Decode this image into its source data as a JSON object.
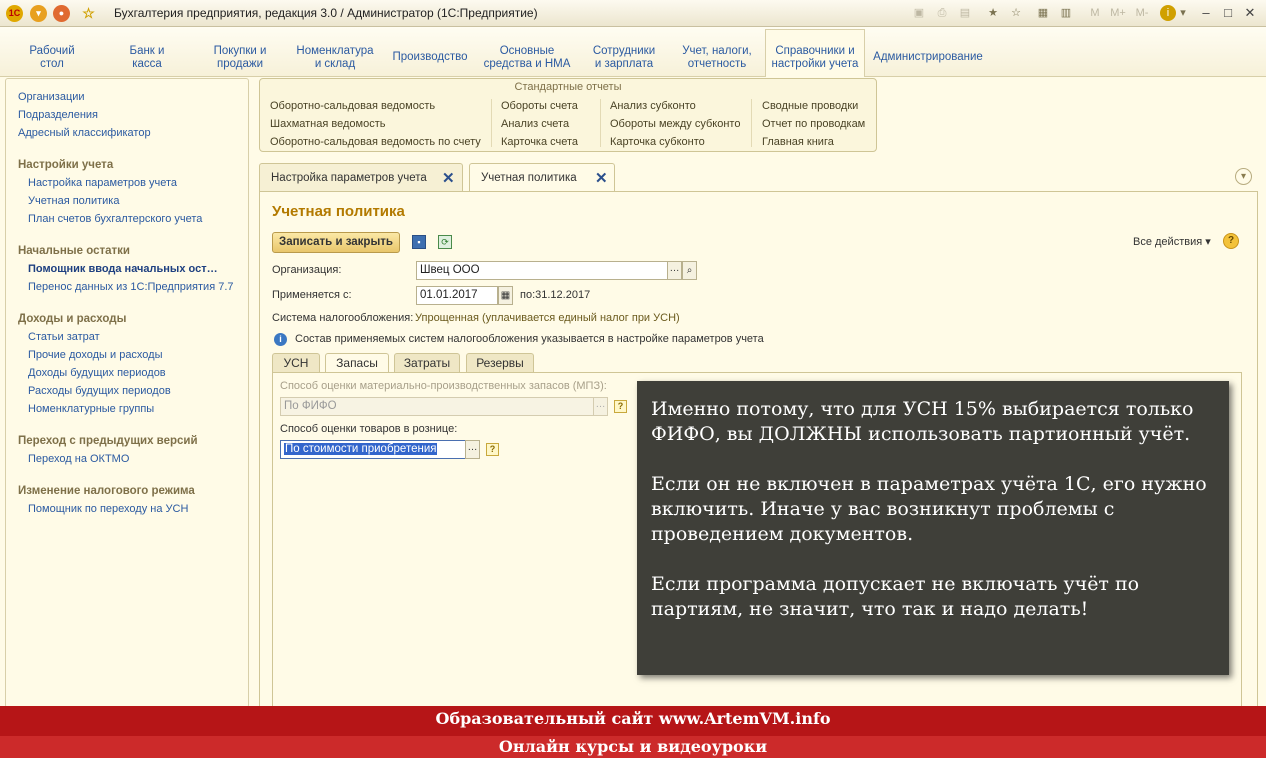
{
  "window": {
    "title": "Бухгалтерия предприятия, редакция 3.0 / Администратор  (1С:Предприятие)",
    "logo": "1С",
    "toolbar_labels": [
      "M",
      "M+",
      "M-"
    ]
  },
  "sections": [
    {
      "label": "Рабочий\nстол"
    },
    {
      "label": "Банк и\nкасса"
    },
    {
      "label": "Покупки и\nпродажи"
    },
    {
      "label": "Номенклатура\nи склад"
    },
    {
      "label": "Производство"
    },
    {
      "label": "Основные\nсредства и НМА"
    },
    {
      "label": "Сотрудники\nи зарплата"
    },
    {
      "label": "Учет, налоги,\nотчетность"
    },
    {
      "label": "Справочники и\nнастройки учета"
    },
    {
      "label": "Администрирование"
    }
  ],
  "sidebar": {
    "top_links": [
      "Организации",
      "Подразделения",
      "Адресный классификатор"
    ],
    "groups": [
      {
        "title": "Настройки учета",
        "items": [
          "Настройка параметров учета",
          "Учетная политика",
          "План счетов бухгалтерского учета"
        ]
      },
      {
        "title": "Начальные остатки",
        "items": [
          "Помощник ввода начальных ост…",
          "Перенос данных из 1С:Предприятия 7.7"
        ]
      },
      {
        "title": "Доходы и расходы",
        "items": [
          "Статьи затрат",
          "Прочие доходы и расходы",
          "Доходы будущих периодов",
          "Расходы будущих периодов",
          "Номенклатурные группы"
        ]
      },
      {
        "title": "Переход с предыдущих версий",
        "items": [
          "Переход на ОКТМО"
        ]
      },
      {
        "title": "Изменение налогового режима",
        "items": [
          "Помощник по переходу на УСН"
        ]
      }
    ]
  },
  "std_reports": {
    "title": "Стандартные отчеты",
    "columns": [
      [
        "Оборотно-сальдовая ведомость",
        "Шахматная ведомость",
        "Оборотно-сальдовая ведомость по счету"
      ],
      [
        "Обороты счета",
        "Анализ счета",
        "Карточка счета"
      ],
      [
        "Анализ субконто",
        "Обороты между субконто",
        "Карточка субконто"
      ],
      [
        "Сводные проводки",
        "Отчет по проводкам",
        "Главная книга"
      ]
    ]
  },
  "doc_tabs": [
    "Настройка параметров учета",
    "Учетная политика"
  ],
  "form": {
    "title": "Учетная политика",
    "save_close": "Записать и закрыть",
    "all_actions": "Все действия",
    "org_label": "Организация:",
    "org_value": "Швец ООО",
    "applies_label": "Применяется с:",
    "applies_value": "01.01.2017",
    "to_label": "по:",
    "to_value": "31.12.2017",
    "tax_label": "Система налогообложения:",
    "tax_value": "Упрощенная (уплачивается единый налог при УСН)",
    "info": "Состав применяемых систем налогообложения указывается в настройке параметров учета",
    "tabs": [
      "УСН",
      "Запасы",
      "Затраты",
      "Резервы"
    ],
    "mpz_label": "Способ оценки материально-производственных запасов (МПЗ):",
    "mpz_value": "По ФИФО",
    "retail_label": "Способ оценки товаров в рознице:",
    "retail_value": "По стоимости приобретения"
  },
  "overlay": {
    "paragraphs": [
      "Именно потому, что для УСН 15% выбирается только ФИФО, вы ДОЛЖНЫ использовать партионный учёт.",
      "Если он не включен в параметрах учёта 1С, его нужно включить. Иначе у вас возникнут проблемы с проведением документов.",
      "Если программа допускает не включать учёт по партиям, не значит, что так и надо делать!"
    ]
  },
  "banner": {
    "line1": "Образовательный сайт www.ArtemVM.info",
    "line2": "Онлайн курсы и видеоуроки"
  },
  "colors": {
    "accent": "#b37a00",
    "link": "#2b5aa1",
    "banner": "#b61517"
  }
}
